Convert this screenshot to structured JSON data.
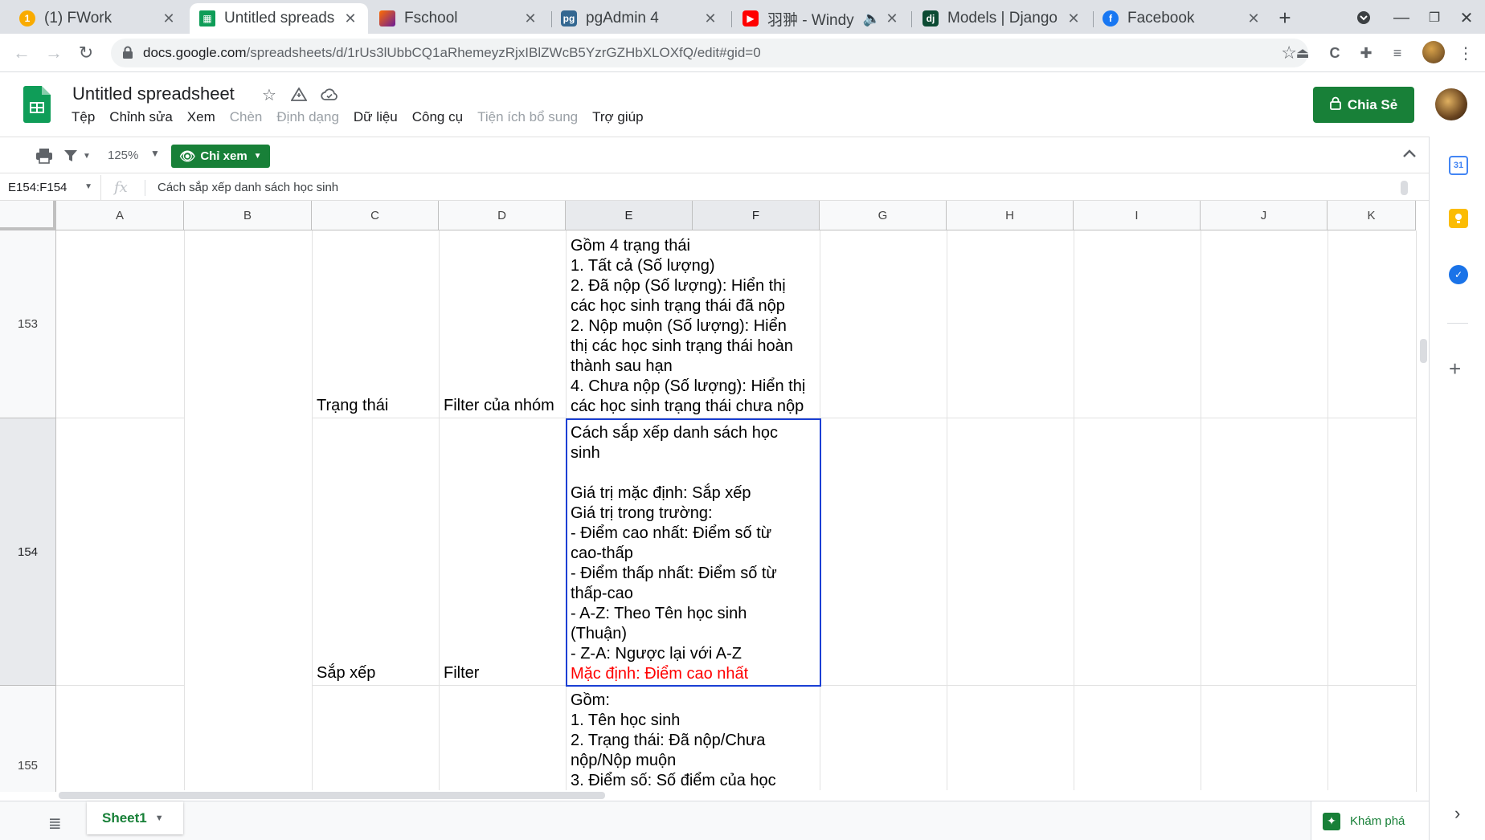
{
  "browser": {
    "tabs": [
      {
        "title": "(1) FWork",
        "icon": "fwork-icon",
        "active": false
      },
      {
        "title": "Untitled spreads",
        "icon": "sheets-icon",
        "active": true
      },
      {
        "title": "Fschool",
        "icon": "fschool-icon",
        "active": false
      },
      {
        "title": "pgAdmin 4",
        "icon": "pgadmin-icon",
        "active": false
      },
      {
        "title": "羽翀 - Windy",
        "icon": "youtube-icon",
        "active": false
      },
      {
        "title": "Models | Django",
        "icon": "django-icon",
        "active": false
      },
      {
        "title": "Facebook",
        "icon": "facebook-icon",
        "active": false
      }
    ],
    "url_host": "docs.google.com",
    "url_path": "/spreadsheets/d/1rUs3lUbbCQ1aRhemeyzRjxIBlZWcB5YzrGZHbXLOXfQ/edit#gid=0"
  },
  "doc": {
    "title": "Untitled spreadsheet",
    "menus": [
      {
        "label": "Tệp",
        "disabled": false
      },
      {
        "label": "Chỉnh sửa",
        "disabled": false
      },
      {
        "label": "Xem",
        "disabled": false
      },
      {
        "label": "Chèn",
        "disabled": true
      },
      {
        "label": "Định dạng",
        "disabled": true
      },
      {
        "label": "Dữ liệu",
        "disabled": false
      },
      {
        "label": "Công cụ",
        "disabled": false
      },
      {
        "label": "Tiện ích bổ sung",
        "disabled": true
      },
      {
        "label": "Trợ giúp",
        "disabled": false
      }
    ],
    "share_label": "Chia Sẻ"
  },
  "toolbar": {
    "zoom": "125%",
    "view_only_label": "Chỉ xem"
  },
  "formula_bar": {
    "name_box": "E154:F154",
    "fx_label": "fx",
    "content": "Cách sắp xếp danh sách học sinh"
  },
  "grid": {
    "columns": [
      "A",
      "B",
      "C",
      "D",
      "E",
      "F",
      "G",
      "H",
      "I",
      "J",
      "K"
    ],
    "rows": [
      {
        "number": "153",
        "c": "Trạng thái",
        "d": "Filter của nhóm",
        "e": [
          "Gồm 4 trạng thái",
          "1. Tất cả  (Số lượng)",
          "2. Đã nộp  (Số lượng): Hiển thị",
          "các học sinh trạng thái đã nộp",
          "2. Nộp muộn  (Số lượng): Hiển",
          "thị các học sinh trạng thái hoàn",
          "thành sau hạn",
          "4. Chưa nộp (Số lượng): Hiển thị",
          "các học sinh trạng thái chưa nộp"
        ]
      },
      {
        "number": "154",
        "c": "Sắp xếp",
        "d": "Filter",
        "e": [
          "Cách sắp xếp danh sách học",
          "sinh",
          "",
          "Giá trị mặc định: Sắp xếp",
          "Giá trị trong trường:",
          "- Điểm cao nhất: Điểm số từ",
          "cao-thấp",
          "- Điểm thấp nhất: Điểm số từ",
          "thấp-cao",
          "- A-Z: Theo Tên học sinh",
          "(Thuận)",
          "- Z-A: Ngược lại với A-Z"
        ],
        "e_red": "Mặc định: Điểm cao nhất"
      },
      {
        "number": "155",
        "c": "",
        "d": "",
        "e": [
          "Gồm:",
          "1. Tên học sinh",
          "2. Trạng thái: Đã nộp/Chưa",
          "nộp/Nộp muộn",
          "3. Điểm số: Số điểm của học"
        ]
      }
    ]
  },
  "bottom": {
    "sheet_name": "Sheet1",
    "explore_label": "Khám phá"
  },
  "side_panel": {
    "calendar_text": "31"
  },
  "colors": {
    "sheets_green": "#188038",
    "selection_blue": "#1a3fd4",
    "red_text": "#ff0000"
  }
}
